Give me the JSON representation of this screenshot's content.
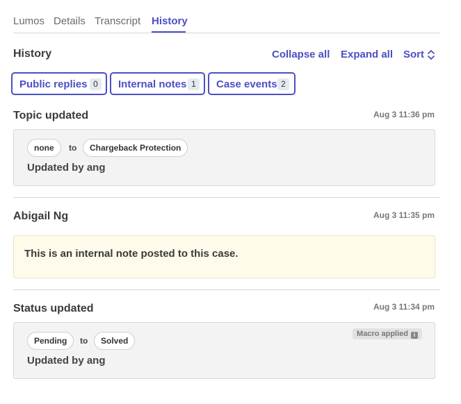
{
  "tabs": [
    {
      "label": "Lumos"
    },
    {
      "label": "Details"
    },
    {
      "label": "Transcript"
    },
    {
      "label": "History",
      "active": true
    }
  ],
  "history": {
    "title": "History",
    "collapse_label": "Collapse all",
    "expand_label": "Expand all",
    "sort_label": "Sort",
    "sort_icon": "chevron-up-down-icon"
  },
  "filters": [
    {
      "label": "Public replies",
      "count": "0"
    },
    {
      "label": "Internal notes",
      "count": "1"
    },
    {
      "label": "Case events",
      "count": "2"
    }
  ],
  "events": [
    {
      "title": "Topic updated",
      "time": "Aug 3 11:36 pm",
      "from": "none",
      "to_word": "to",
      "to": "Chargeback Protection",
      "updated_by": "Updated by ang"
    },
    {
      "title": "Abigail Ng",
      "time": "Aug 3 11:35 pm",
      "note": "This is an internal note posted to this case."
    },
    {
      "title": "Status updated",
      "time": "Aug 3 11:34 pm",
      "from": "Pending",
      "to_word": "to",
      "to": "Solved",
      "updated_by": "Updated by ang",
      "badge": "Macro applied",
      "badge_icon": "info-icon"
    }
  ],
  "colors": {
    "accent": "#4a4fc4",
    "card_bg": "#f3f3f3",
    "note_bg": "#fefbea"
  }
}
